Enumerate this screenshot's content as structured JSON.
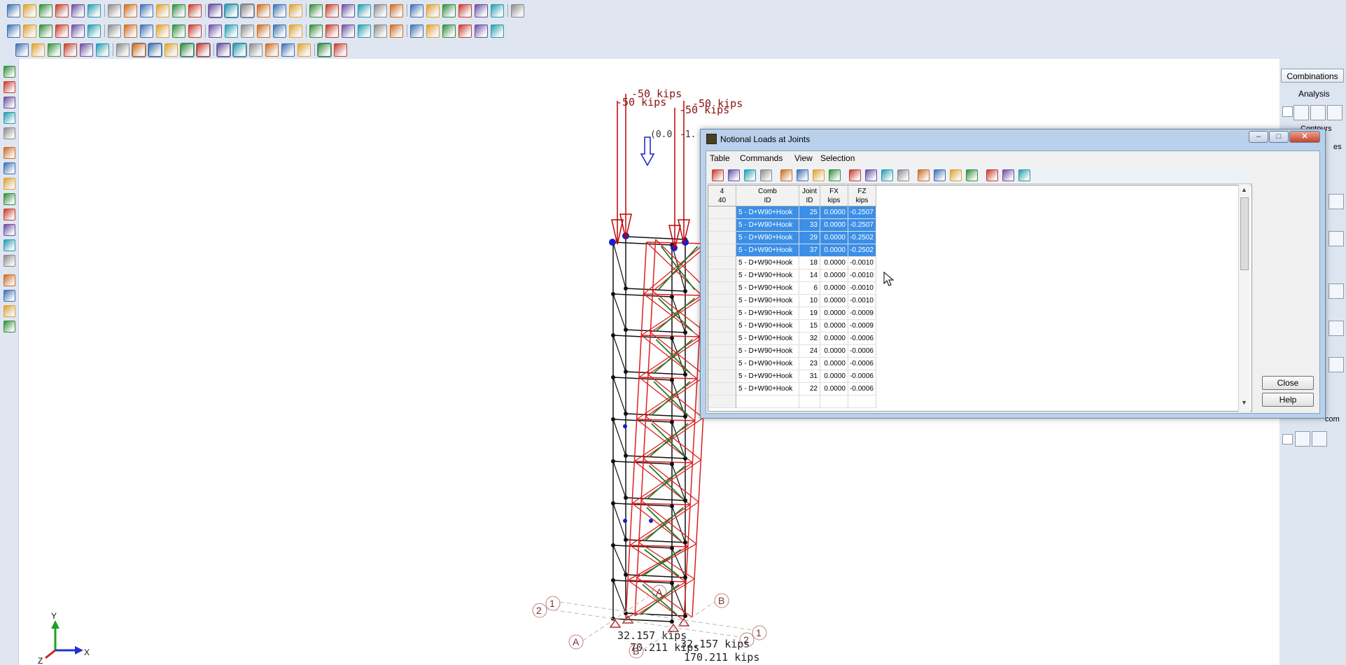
{
  "colors": {
    "accent": "#3b8fe6",
    "frame_black": "#111111",
    "frame_red": "#dd1f1f",
    "frame_green": "#1f7a2a",
    "load_red": "#c00000",
    "joint_blue": "#1720c8"
  },
  "toolbars": {
    "row1_icons": [
      "new-icon",
      "open-icon",
      "save-icon",
      "print-icon",
      "undo-icon",
      "redo-icon",
      "draw-member-icon",
      "2d-3d-icon",
      "rotate-icon",
      "line-icon",
      "graphics-icon",
      "window-icon",
      "select-icon",
      "view-icon",
      "table-icon",
      "grid-icon",
      "section-icon",
      "brace-icon",
      "load-icon",
      "member-icon",
      "plate-icon",
      "solid-icon",
      "boundary-icon",
      "column-icon",
      "beam-icon",
      "query-icon",
      "results-icon",
      "find-icon",
      "clone-icon",
      "report-icon",
      "zoom-search-icon"
    ],
    "row2_icons": [
      "table-icon",
      "joint-icon",
      "member-icon",
      "plate-icon",
      "check-icon",
      "filter-icon",
      "graph-icon",
      "delete-icon",
      "split-icon",
      "merge-icon",
      "move-icon",
      "rotate-icon",
      "mirror-icon",
      "scale-icon",
      "reset-icon",
      "frame-icon",
      "solve-icon",
      "mesh-icon",
      "node-icon",
      "divide-icon",
      "brace-icon",
      "truss-icon",
      "color-wheel-icon",
      "paint-icon",
      "tabs-icon",
      "copy-icon",
      "paste-icon",
      "export-icon",
      "import-icon",
      "settings-icon"
    ],
    "row3_icons": [
      "select-all-icon",
      "select-box-icon",
      "unselect-icon",
      "invert-icon",
      "copy-view-icon",
      "paste-view-icon",
      "stack-icon",
      "pointer-icon",
      "pointer-line-icon",
      "pointer-plus-icon",
      "window-select-icon",
      "window-unselect-icon",
      "box-select-icon",
      "box-unselect-icon",
      "lasso-icon",
      "polygon-icon",
      "criteria-icon",
      "save-selection-icon",
      "recall-selection-icon",
      "check-box-icon"
    ],
    "left_icons": [
      "pan-hand-icon",
      "globe-icon",
      "grid-dots-icon",
      "rotate-view-icon",
      "zoom-icon",
      "zoom-out-icon",
      "iso-view-icon",
      "front-view-icon",
      "side-view-icon",
      "top-view-icon",
      "box-view-icon",
      "plate-view-icon",
      "solid-view-icon",
      "fit-icon",
      "vehicle-icon",
      "eye-icon",
      "layers-icon"
    ]
  },
  "right_panel": {
    "combinations_label": "Combinations",
    "analysis_label": "Analysis",
    "contours_label": "Contours",
    "es_label": "es",
    "com_label": "com"
  },
  "canvas": {
    "load_labels": [
      "-50 kips",
      "-50 kips",
      "-50 kips",
      "-50 kips"
    ],
    "small_label": "(0.0",
    "small_label2": "-1.",
    "reaction_labels": [
      "32.157 kips",
      "70.211 kips",
      "32.157 kips",
      "170.211 kips"
    ],
    "grid_bubbles": [
      "2",
      "1",
      "A",
      "B",
      "A",
      "B",
      "2",
      "1"
    ],
    "axis": {
      "x": "X",
      "y": "Y",
      "z": "Z"
    }
  },
  "dialog": {
    "title": "Notional Loads at Joints",
    "menus": [
      "Table",
      "Commands",
      "View",
      "Selection"
    ],
    "toolbar_icons": [
      "print-preview-icon",
      "print-icon",
      "paste-icon",
      "copy-icon",
      "camera-icon",
      "insert-row-icon",
      "delete-row-icon",
      "import-icon",
      "export-icon",
      "find-icon",
      "replace-icon",
      "sort-ascending-icon",
      "sort-descending-icon",
      "filter-icon",
      "unfilter-icon",
      "grid-view-icon",
      "columns-icon",
      "rows-icon",
      "excel-icon"
    ],
    "table": {
      "corner_top": "4",
      "corner_bottom": "40",
      "headers": [
        {
          "line1": "Comb",
          "line2": "ID"
        },
        {
          "line1": "Joint",
          "line2": "ID"
        },
        {
          "line1": "FX",
          "line2": "kips"
        },
        {
          "line1": "FZ",
          "line2": "kips"
        }
      ],
      "rows": [
        {
          "comb": "5 - D+W90+Hook",
          "joint": "25",
          "fx": "0.0000",
          "fz": "-0.2507",
          "selected": true
        },
        {
          "comb": "5 - D+W90+Hook",
          "joint": "33",
          "fx": "0.0000",
          "fz": "-0.2507",
          "selected": true
        },
        {
          "comb": "5 - D+W90+Hook",
          "joint": "29",
          "fx": "0.0000",
          "fz": "-0.2502",
          "selected": true
        },
        {
          "comb": "5 - D+W90+Hook",
          "joint": "37",
          "fx": "0.0000",
          "fz": "-0.2502",
          "selected": true
        },
        {
          "comb": "5 - D+W90+Hook",
          "joint": "18",
          "fx": "0.0000",
          "fz": "-0.0010",
          "selected": false
        },
        {
          "comb": "5 - D+W90+Hook",
          "joint": "14",
          "fx": "0.0000",
          "fz": "-0.0010",
          "selected": false
        },
        {
          "comb": "5 - D+W90+Hook",
          "joint": "6",
          "fx": "0.0000",
          "fz": "-0.0010",
          "selected": false
        },
        {
          "comb": "5 - D+W90+Hook",
          "joint": "10",
          "fx": "0.0000",
          "fz": "-0.0010",
          "selected": false
        },
        {
          "comb": "5 - D+W90+Hook",
          "joint": "19",
          "fx": "0.0000",
          "fz": "-0.0009",
          "selected": false
        },
        {
          "comb": "5 - D+W90+Hook",
          "joint": "15",
          "fx": "0.0000",
          "fz": "-0.0009",
          "selected": false
        },
        {
          "comb": "5 - D+W90+Hook",
          "joint": "32",
          "fx": "0.0000",
          "fz": "-0.0006",
          "selected": false
        },
        {
          "comb": "5 - D+W90+Hook",
          "joint": "24",
          "fx": "0.0000",
          "fz": "-0.0006",
          "selected": false
        },
        {
          "comb": "5 - D+W90+Hook",
          "joint": "23",
          "fx": "0.0000",
          "fz": "-0.0006",
          "selected": false
        },
        {
          "comb": "5 - D+W90+Hook",
          "joint": "31",
          "fx": "0.0000",
          "fz": "-0.0006",
          "selected": false
        },
        {
          "comb": "5 - D+W90+Hook",
          "joint": "22",
          "fx": "0.0000",
          "fz": "-0.0006",
          "selected": false
        }
      ]
    },
    "close_label": "Close",
    "help_label": "Help"
  }
}
